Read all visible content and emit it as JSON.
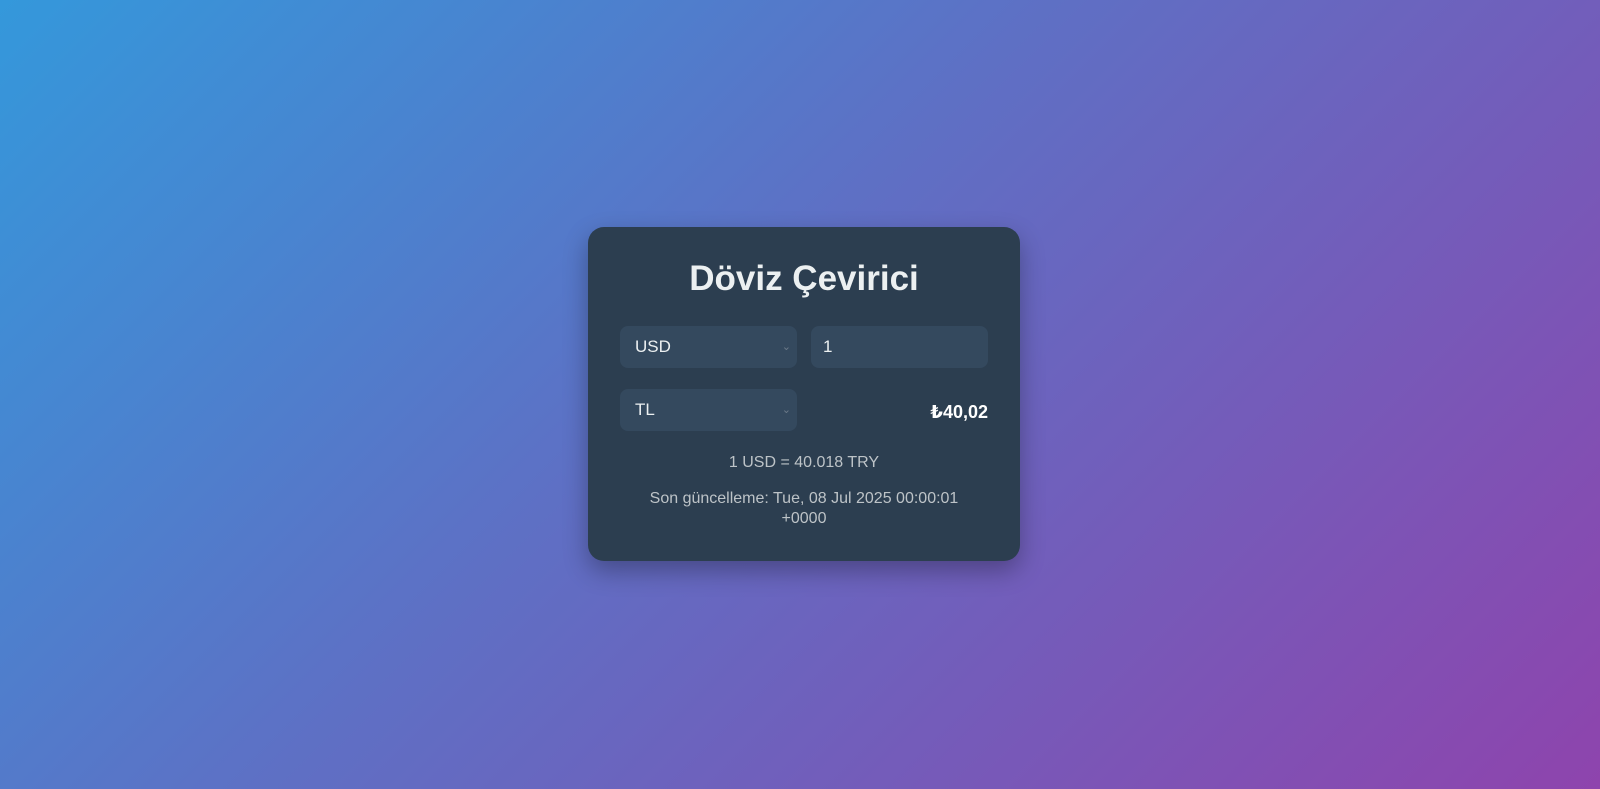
{
  "converter": {
    "title": "Döviz Çevirici",
    "from_currency": "USD",
    "amount": "1",
    "to_currency": "TL",
    "result": "₺40,02",
    "rate_text": "1 USD = 40.018 TRY",
    "last_updated": "Son güncelleme: Tue, 08 Jul 2025 00:00:01 +0000"
  },
  "icons": {
    "chevron": "chevron-down-icon"
  },
  "colors": {
    "card_bg": "#2c3e50",
    "field_bg": "#34495e",
    "gradient_start": "#3498db",
    "gradient_end": "#8e44ad"
  }
}
